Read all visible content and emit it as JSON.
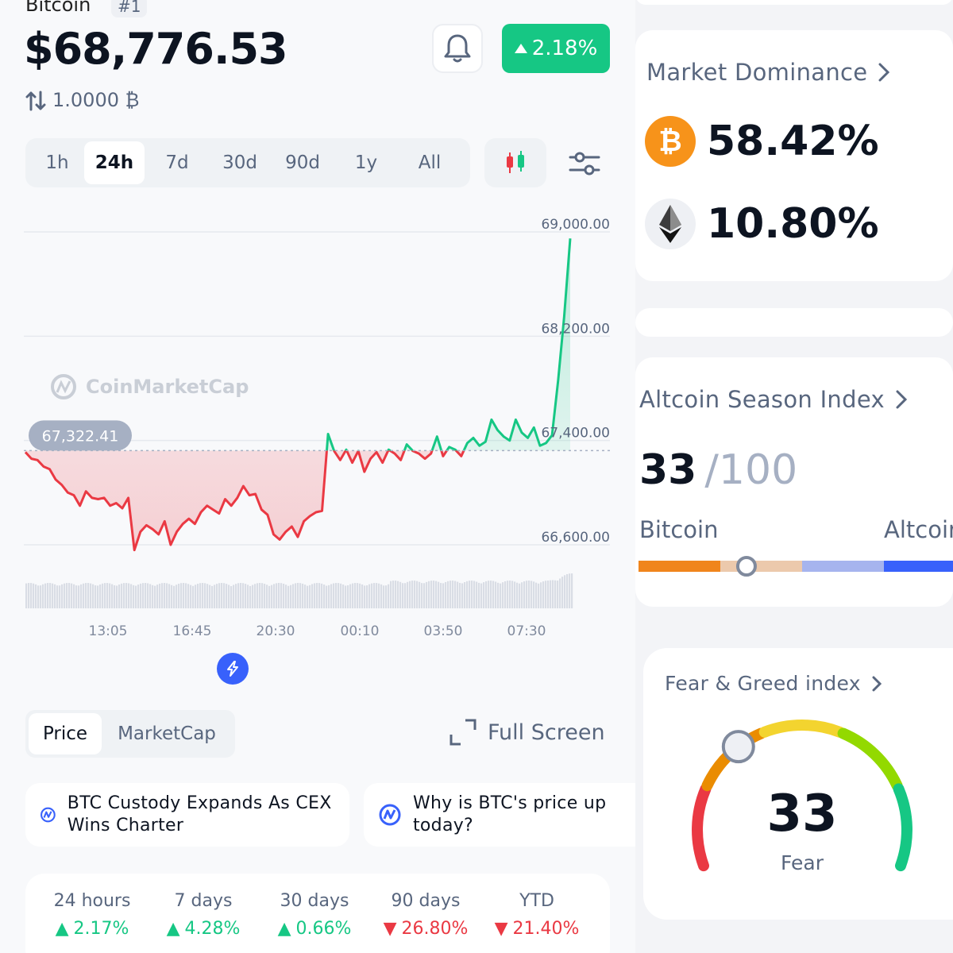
{
  "coin": {
    "name": "Bitcoin",
    "rank": "#1",
    "price": "$68,776.53",
    "change_24h": "2.18%",
    "conversion": "1.0000 ₿"
  },
  "range_tabs": [
    "1h",
    "24h",
    "7d",
    "30d",
    "90d",
    "1y",
    "All"
  ],
  "active_range": "24h",
  "chart_data": {
    "type": "line",
    "y_ticks": [
      "69,000.00",
      "68,200.00",
      "67,400.00",
      "66,600.00"
    ],
    "ylim": [
      66600,
      69000
    ],
    "x_ticks": [
      "13:05",
      "16:45",
      "20:30",
      "00:10",
      "03:50",
      "07:30"
    ],
    "reference_price": 67322.41,
    "reference_label": "67,322.41",
    "watermark": "CoinMarketCap",
    "series": [
      {
        "values": [
          67310,
          67260,
          67250,
          67200,
          67180,
          67100,
          67060,
          67000,
          66980,
          66900,
          67010,
          66960,
          66950,
          66960,
          66900,
          66920,
          66880,
          66960,
          66560,
          66700,
          66750,
          66720,
          66680,
          66780,
          66600,
          66700,
          66760,
          66800,
          66760,
          66850,
          66900,
          66870,
          66840,
          66950,
          66900,
          66960,
          67050,
          66980,
          66990,
          66870,
          66830,
          66680,
          66640,
          66700,
          66740,
          66660,
          66780,
          66820,
          66850,
          66860,
          67450,
          67320,
          67250,
          67330,
          67230,
          67320,
          67160,
          67260,
          67310,
          67230,
          67330,
          67300,
          67250,
          67370,
          67320,
          67300,
          67260,
          67300,
          67430,
          67280,
          67350,
          67330,
          67280,
          67380,
          67420,
          67360,
          67390,
          67560,
          67480,
          67430,
          67400,
          67560,
          67460,
          67420,
          67500,
          67360,
          67380,
          67440,
          67860,
          68350,
          68950
        ]
      }
    ],
    "colors": {
      "above": "#16c784",
      "below": "#ea3943"
    }
  },
  "toggle": {
    "price": "Price",
    "marketcap": "MarketCap"
  },
  "full_screen_label": "Full Screen",
  "news": [
    "BTC Custody Expands As CEX Wins Charter",
    "Why is BTC's price up today?"
  ],
  "performance": [
    {
      "label": "24 hours",
      "value": "2.17%",
      "dir": "up"
    },
    {
      "label": "7 days",
      "value": "4.28%",
      "dir": "up"
    },
    {
      "label": "30 days",
      "value": "0.66%",
      "dir": "up"
    },
    {
      "label": "90 days",
      "value": "26.80%",
      "dir": "down"
    },
    {
      "label": "YTD",
      "value": "21.40%",
      "dir": "down"
    }
  ],
  "market_dominance": {
    "title": "Market Dominance",
    "btc": "58.42%",
    "eth": "10.80%"
  },
  "altcoin_season": {
    "title": "Altcoin Season Index",
    "value": "33",
    "total": "/100",
    "left_label": "Bitcoin",
    "right_label": "Altcoin",
    "level": 0.33
  },
  "fear_greed": {
    "title": "Fear & Greed index",
    "value": "33",
    "label": "Fear",
    "level": 0.33
  }
}
